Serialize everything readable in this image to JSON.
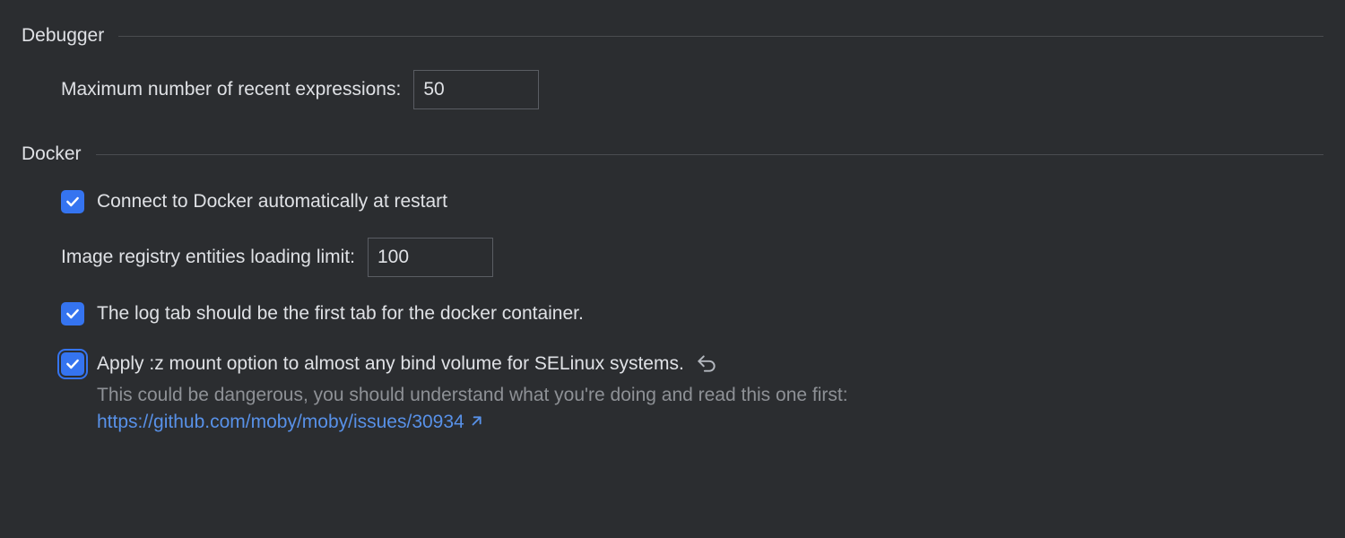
{
  "debugger": {
    "title": "Debugger",
    "max_expressions": {
      "label": "Maximum number of recent expressions:",
      "value": "50"
    }
  },
  "docker": {
    "title": "Docker",
    "auto_connect": {
      "label": "Connect to Docker automatically at restart",
      "checked": true
    },
    "registry_limit": {
      "label": "Image registry entities loading limit:",
      "value": "100"
    },
    "log_tab_first": {
      "label": "The log tab should be the first tab for the docker container.",
      "checked": true
    },
    "z_mount": {
      "label": "Apply :z mount option to almost any bind volume for SELinux systems.",
      "checked": true,
      "help_text": "This could be dangerous, you should understand what you're doing and read this one first:",
      "help_link": "https://github.com/moby/moby/issues/30934"
    }
  }
}
